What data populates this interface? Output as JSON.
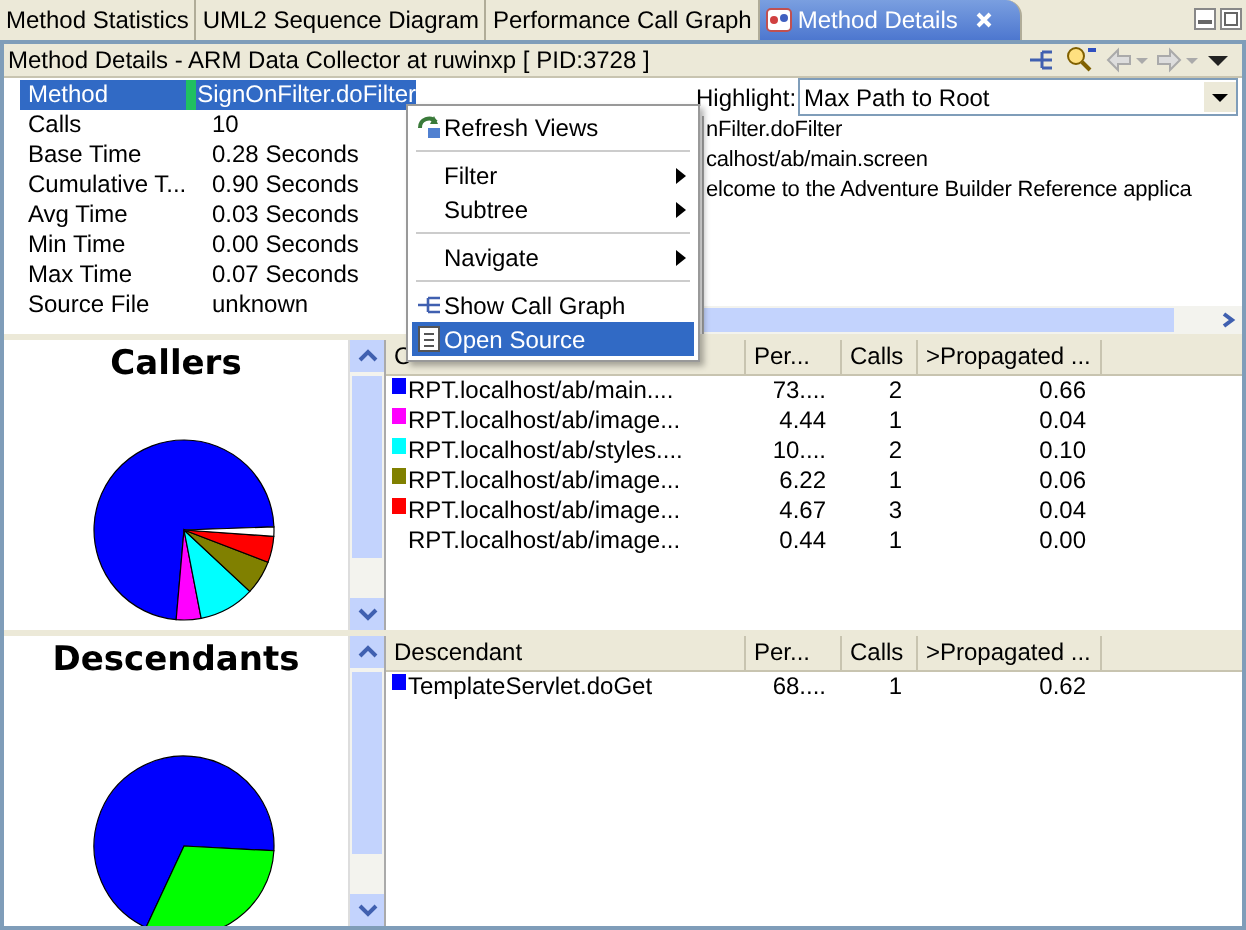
{
  "tabs": [
    {
      "label": "Method Statistics",
      "selected": false,
      "closable": false
    },
    {
      "label": "UML2 Sequence Diagram",
      "selected": false,
      "closable": false
    },
    {
      "label": "Performance Call Graph",
      "selected": false,
      "closable": false
    },
    {
      "label": "Method Details",
      "selected": true,
      "closable": true
    }
  ],
  "view_title": "Method Details - ARM Data Collector at ruwinxp [ PID:3728 ]",
  "properties": [
    {
      "name": "Method",
      "value": "SignOnFilter.doFilter",
      "selected": true
    },
    {
      "name": "Calls",
      "value": "10",
      "selected": false
    },
    {
      "name": "Base Time",
      "value": "0.28 Seconds",
      "selected": false
    },
    {
      "name": "Cumulative T...",
      "value": "0.90 Seconds",
      "selected": false
    },
    {
      "name": "Avg Time",
      "value": "0.03 Seconds",
      "selected": false
    },
    {
      "name": "Min Time",
      "value": "0.00 Seconds",
      "selected": false
    },
    {
      "name": "Max Time",
      "value": "0.07 Seconds",
      "selected": false
    },
    {
      "name": "Source File",
      "value": "unknown",
      "selected": false
    }
  ],
  "highlight": {
    "label": "Highlight:",
    "value": "Max Path to Root"
  },
  "source_lines": [
    "nFilter.doFilter",
    "calhost/ab/main.screen",
    "elcome to the Adventure Builder Reference applica"
  ],
  "context_menu": [
    [
      {
        "label": "Refresh Views",
        "submenu": false,
        "selected": false
      }
    ],
    [
      {
        "label": "Filter",
        "submenu": true,
        "selected": false
      },
      {
        "label": "Subtree",
        "submenu": true,
        "selected": false
      }
    ],
    [
      {
        "label": "Navigate",
        "submenu": true,
        "selected": false
      }
    ],
    [
      {
        "label": "Show Call Graph",
        "submenu": false,
        "selected": false
      },
      {
        "label": "Open Source",
        "submenu": false,
        "selected": true
      }
    ]
  ],
  "sections": [
    {
      "title": "Callers",
      "columns": [
        "C",
        "Per...",
        "Calls",
        ">Propagated ..."
      ],
      "rows": [
        {
          "cells": [
            "RPT.localhost/ab/main....",
            "73....",
            "2",
            "0.66"
          ],
          "color": "#0000ff"
        },
        {
          "cells": [
            "RPT.localhost/ab/image...",
            "4.44",
            "1",
            "0.04"
          ],
          "color": "#ff00ff"
        },
        {
          "cells": [
            "RPT.localhost/ab/styles....",
            "10....",
            "2",
            "0.10"
          ],
          "color": "#00ffff"
        },
        {
          "cells": [
            "RPT.localhost/ab/image...",
            "6.22",
            "1",
            "0.06"
          ],
          "color": "#808000"
        },
        {
          "cells": [
            "RPT.localhost/ab/image...",
            "4.67",
            "3",
            "0.04"
          ],
          "color": "#ff0000"
        },
        {
          "cells": [
            "RPT.localhost/ab/image...",
            "0.44",
            "1",
            "0.00"
          ]
        }
      ]
    },
    {
      "title": "Descendants",
      "columns": [
        "Descendant",
        "Per...",
        "Calls",
        ">Propagated ..."
      ],
      "rows": [
        {
          "cells": [
            "TemplateServlet.doGet",
            "68....",
            "1",
            "0.62"
          ],
          "color": "#0000ff"
        }
      ]
    }
  ]
}
